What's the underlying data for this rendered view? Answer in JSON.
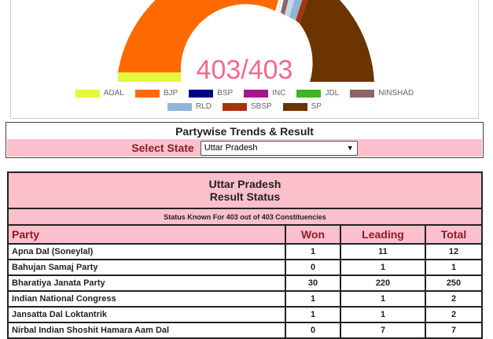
{
  "chart": {
    "center_label": "403/403",
    "legend_row1": [
      {
        "name": "ADAL",
        "color": "#e8f53c"
      },
      {
        "name": "BJP",
        "color": "#ff6a00"
      },
      {
        "name": "BSP",
        "color": "#00008b"
      },
      {
        "name": "INC",
        "color": "#a8168f"
      },
      {
        "name": "JDL",
        "color": "#3cb521"
      },
      {
        "name": "NINSHAD",
        "color": "#8e6466"
      }
    ],
    "legend_row2": [
      {
        "name": "RLD",
        "color": "#8fb6d9"
      },
      {
        "name": "SBSP",
        "color": "#a93310"
      },
      {
        "name": "SP",
        "color": "#6b3400"
      }
    ]
  },
  "trends": {
    "title": "Partywise Trends & Result",
    "state_label": "Select State",
    "selected_state": "Uttar Pradesh"
  },
  "results": {
    "state_name": "Uttar Pradesh",
    "subtitle": "Result Status",
    "status_line": "Status Known For 403 out of 403 Constituencies",
    "columns": [
      "Party",
      "Won",
      "Leading",
      "Total"
    ],
    "rows": [
      [
        "Apna Dal (Soneylal)",
        "1",
        "11",
        "12"
      ],
      [
        "Bahujan Samaj Party",
        "0",
        "1",
        "1"
      ],
      [
        "Bharatiya Janata Party",
        "30",
        "220",
        "250"
      ],
      [
        "Indian National Congress",
        "1",
        "1",
        "2"
      ],
      [
        "Jansatta Dal Loktantrik",
        "1",
        "1",
        "2"
      ],
      [
        "Nirbal Indian Shoshit Hamara Aam Dal",
        "0",
        "7",
        "7"
      ]
    ]
  }
}
